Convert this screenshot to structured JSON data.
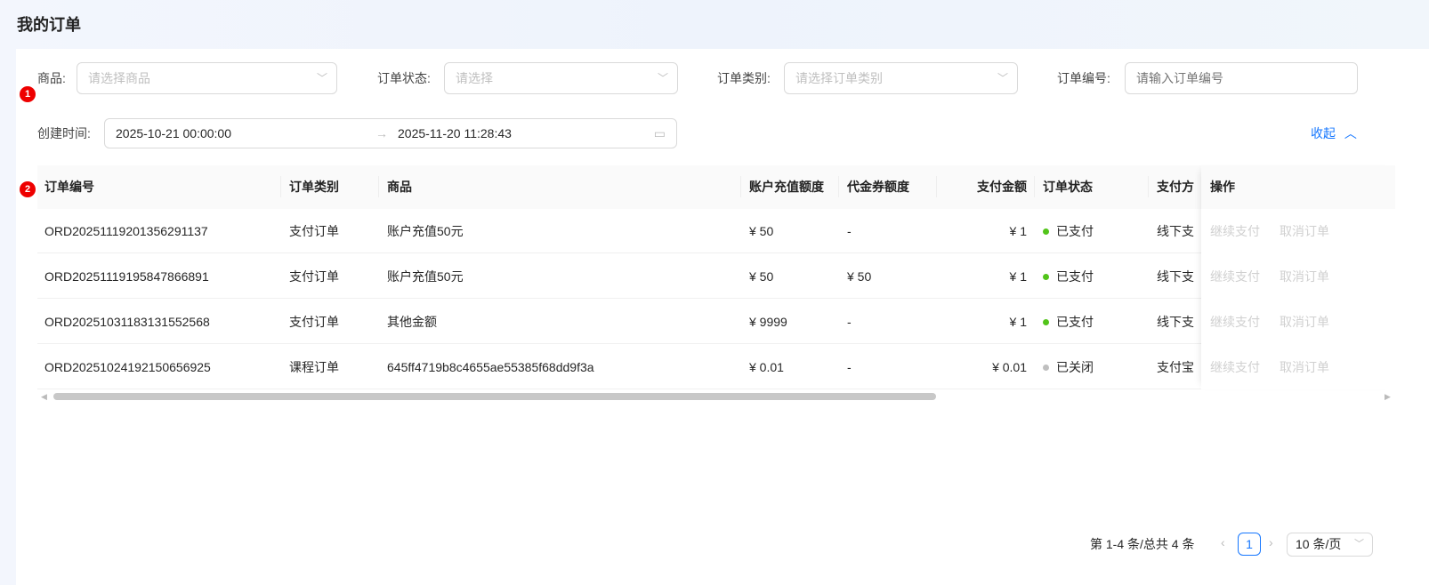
{
  "page": {
    "title": "我的订单"
  },
  "annotations": [
    "1",
    "2"
  ],
  "filters": {
    "product": {
      "label": "商品:",
      "placeholder": "请选择商品"
    },
    "status": {
      "label": "订单状态:",
      "placeholder": "请选择"
    },
    "category": {
      "label": "订单类别:",
      "placeholder": "请选择订单类别"
    },
    "order_no": {
      "label": "订单编号:",
      "placeholder": "请输入订单编号"
    },
    "created": {
      "label": "创建时间:",
      "start": "2025-10-21 00:00:00",
      "end": "2025-11-20 11:28:43"
    },
    "collapse_label": "收起"
  },
  "table": {
    "columns": [
      "订单编号",
      "订单类别",
      "商品",
      "账户充值额度",
      "代金券额度",
      "支付金额",
      "订单状态",
      "支付方",
      "操作"
    ],
    "rows": [
      {
        "order_no": "ORD20251119201356291137",
        "category": "支付订单",
        "product": "账户充值50元",
        "recharge": "¥ 50",
        "voucher": "-",
        "paid": "¥ 1",
        "status": "已支付",
        "status_color": "#52c41a",
        "method": "线下支"
      },
      {
        "order_no": "ORD20251119195847866891",
        "category": "支付订单",
        "product": "账户充值50元",
        "recharge": "¥ 50",
        "voucher": "¥ 50",
        "paid": "¥ 1",
        "status": "已支付",
        "status_color": "#52c41a",
        "method": "线下支"
      },
      {
        "order_no": "ORD20251031183131552568",
        "category": "支付订单",
        "product": "其他金额",
        "recharge": "¥ 9999",
        "voucher": "-",
        "paid": "¥ 1",
        "status": "已支付",
        "status_color": "#52c41a",
        "method": "线下支"
      },
      {
        "order_no": "ORD20251024192150656925",
        "category": "课程订单",
        "product": "645ff4719b8c4655ae55385f68dd9f3a",
        "recharge": "¥ 0.01",
        "voucher": "-",
        "paid": "¥ 0.01",
        "status": "已关闭",
        "status_color": "#bfbfbf",
        "method": "支付宝"
      }
    ],
    "actions": [
      "继续支付",
      "取消订单"
    ]
  },
  "pagination": {
    "summary": "第 1-4 条/总共 4 条",
    "current": "1",
    "page_size": "10 条/页"
  },
  "colors": {
    "accent": "#1677ff"
  }
}
